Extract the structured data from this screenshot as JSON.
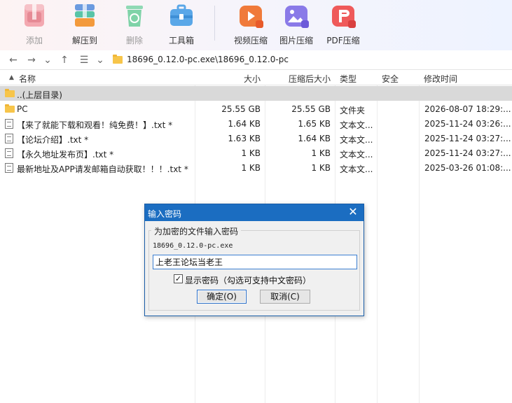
{
  "toolbar": {
    "items": [
      {
        "label": "添加",
        "icon": "add-archive-icon",
        "disabled": true
      },
      {
        "label": "解压到",
        "icon": "extract-to-icon",
        "disabled": false
      },
      {
        "label": "删除",
        "icon": "delete-recycle-icon",
        "disabled": true
      },
      {
        "label": "工具箱",
        "icon": "toolbox-icon",
        "disabled": false
      },
      {
        "label": "视频压缩",
        "icon": "video-compress-icon",
        "disabled": false
      },
      {
        "label": "图片压缩",
        "icon": "image-compress-icon",
        "disabled": false
      },
      {
        "label": "PDF压缩",
        "icon": "pdf-compress-icon",
        "disabled": false
      }
    ]
  },
  "address": {
    "path": "18696_0.12.0-pc.exe\\18696_0.12.0-pc"
  },
  "columns": [
    "名称",
    "大小",
    "压缩后大小",
    "类型",
    "安全",
    "修改时间"
  ],
  "rows": [
    {
      "name": "..(上层目录)",
      "size": "",
      "packed": "",
      "type": "",
      "security": "",
      "modified": "",
      "kind": "parent"
    },
    {
      "name": "PC",
      "size": "25.55 GB",
      "packed": "25.55 GB",
      "type": "文件夹",
      "security": "",
      "modified": "2026-08-07 18:29:...",
      "kind": "folder"
    },
    {
      "name": "【来了就能下载和观看！纯免费！】.txt *",
      "size": "1.64 KB",
      "packed": "1.65 KB",
      "type": "文本文...",
      "security": "",
      "modified": "2025-11-24 03:26:...",
      "kind": "txt"
    },
    {
      "name": "【论坛介绍】.txt *",
      "size": "1.63 KB",
      "packed": "1.64 KB",
      "type": "文本文...",
      "security": "",
      "modified": "2025-11-24 03:27:...",
      "kind": "txt"
    },
    {
      "name": "【永久地址发布页】.txt *",
      "size": "1 KB",
      "packed": "1 KB",
      "type": "文本文...",
      "security": "",
      "modified": "2025-11-24 03:27:...",
      "kind": "txt"
    },
    {
      "name": "最新地址及APP请发邮箱自动获取！！！.txt *",
      "size": "1 KB",
      "packed": "1 KB",
      "type": "文本文...",
      "security": "",
      "modified": "2025-03-26 01:08:...",
      "kind": "txt"
    }
  ],
  "dialog": {
    "title": "输入密码",
    "group_label": "为加密的文件输入密码",
    "filename": "18696_0.12.0-pc.exe",
    "password_value": "上老王论坛当老王",
    "checkbox_checked": true,
    "checkbox_label": "显示密码（勾选可支持中文密码）",
    "ok_label": "确定(O)",
    "cancel_label": "取消(C)"
  },
  "colors": {
    "dialog_title_bg": "#1b6dc1",
    "selected_row": "#d9d9d9",
    "folder": "#f7c54a"
  }
}
